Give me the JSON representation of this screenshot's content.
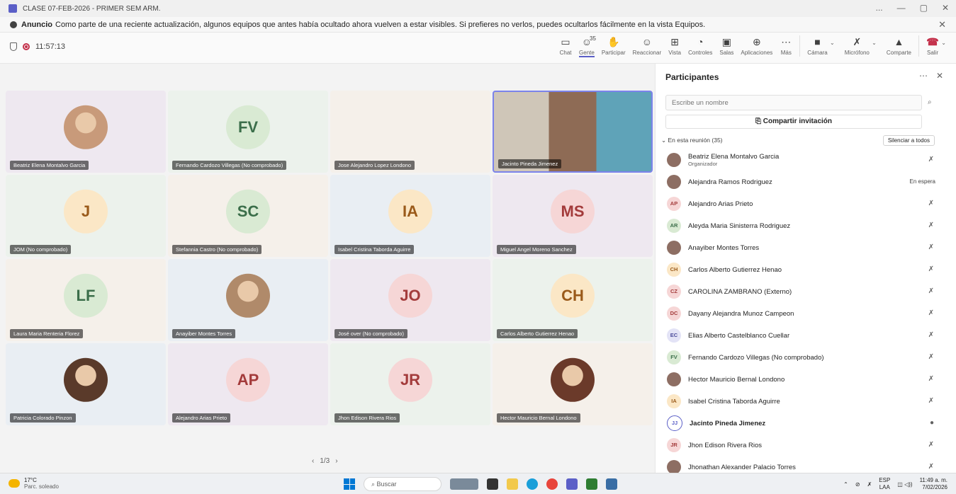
{
  "window": {
    "title": "CLASE 07-FEB-2026 - PRIMER SEM ARM.",
    "controls": [
      "...",
      "—",
      "▢",
      "✕"
    ]
  },
  "announcement": {
    "label": "Anuncio",
    "text": "Como parte de una reciente actualización, algunos equipos que antes había ocultado ahora vuelven a estar visibles. Si prefieres no verlos, puedes ocultarlos fácilmente en la vista Equipos."
  },
  "meeting": {
    "timer": "11:57:13"
  },
  "toolbar": {
    "chat": "Chat",
    "people": "Gente",
    "people_count": "35",
    "raise": "Participar",
    "react": "Reaccionar",
    "view": "Vista",
    "controls": "Controles",
    "rooms": "Salas",
    "apps": "Aplicaciones",
    "more": "Más",
    "camera": "Cámara",
    "mic": "Micrófono",
    "share": "Comparte",
    "leave": "Salir"
  },
  "tiles": [
    {
      "name": "Beatriz Elena Montalvo Garcia",
      "initials": "",
      "photo_color": "#c89a7a"
    },
    {
      "name": "Fernando Cardozo Villegas (No comprobado)",
      "initials": "FV",
      "color": "#d9ead3",
      "text_color": "#3b6e4a"
    },
    {
      "name": "Jose Alejandro Lopez Londono",
      "initials": "",
      "photo_color": ""
    },
    {
      "name": "Jacinto Pineda Jimenez",
      "initials": "",
      "photo_color": "#a07860"
    },
    {
      "name": "JOM (No comprobado)",
      "initials": "J",
      "color": "#fbe7c6",
      "text_color": "#9a5a1a"
    },
    {
      "name": "Stefannia Castro (No comprobado)",
      "initials": "SC",
      "color": "#d9ead3",
      "text_color": "#3b6e4a"
    },
    {
      "name": "Isabel Cristina Taborda Aguirre",
      "initials": "IA",
      "color": "#fbe7c6",
      "text_color": "#9a5a1a"
    },
    {
      "name": "Miguel Angel Moreno Sanchez",
      "initials": "MS",
      "color": "#f6d6d6",
      "text_color": "#a33b3b"
    },
    {
      "name": "Laura Maria Renteria Florez",
      "initials": "LF",
      "color": "#d9ead3",
      "text_color": "#3b6e4a"
    },
    {
      "name": "Anayiber Montes Torres",
      "initials": "",
      "photo_color": "#b08a6a"
    },
    {
      "name": "José over (No comprobado)",
      "initials": "JO",
      "color": "#f6d6d6",
      "text_color": "#a33b3b"
    },
    {
      "name": "Carlos Alberto Gutierrez Henao",
      "initials": "CH",
      "color": "#fbe7c6",
      "text_color": "#9a5a1a"
    },
    {
      "name": "Patricia Colorado Pinzon",
      "initials": "",
      "photo_color": "#5a3a2a"
    },
    {
      "name": "Alejandro Arias Prieto",
      "initials": "AP",
      "color": "#f6d6d6",
      "text_color": "#a33b3b"
    },
    {
      "name": "Jhon Edison Rivera Rios",
      "initials": "JR",
      "color": "#f6d6d6",
      "text_color": "#a33b3b"
    },
    {
      "name": "Hector Mauricio Bernal Londono",
      "initials": "",
      "photo_color": "#6b3a2a"
    }
  ],
  "pager": {
    "prev": "‹",
    "text": "1/3",
    "next": "›"
  },
  "panel": {
    "title": "Participantes",
    "search_placeholder": "Escribe un nombre",
    "invite": "Compartir invitación",
    "section": "En esta reunión (35)",
    "mute_all": "Silenciar a todos",
    "participants": [
      {
        "name": "Beatriz Elena Montalvo Garcia",
        "role": "Organizador",
        "initials": "",
        "status": ""
      },
      {
        "name": "Alejandra Ramos Rodriguez",
        "role": "",
        "initials": "",
        "status": "En espera"
      },
      {
        "name": "Alejandro Arias Prieto",
        "role": "",
        "initials": "AP",
        "status": ""
      },
      {
        "name": "Aleyda Maria Sinisterra Rodriguez",
        "role": "",
        "initials": "AR",
        "status": ""
      },
      {
        "name": "Anayiber Montes Torres",
        "role": "",
        "initials": "",
        "status": ""
      },
      {
        "name": "Carlos Alberto Gutierrez Henao",
        "role": "",
        "initials": "CH",
        "status": ""
      },
      {
        "name": "CAROLINA ZAMBRANO (Externo)",
        "role": "",
        "initials": "CZ",
        "status": ""
      },
      {
        "name": "Dayany Alejandra Munoz Campeon",
        "role": "",
        "initials": "DC",
        "status": ""
      },
      {
        "name": "Elias Alberto Castelblanco Cuellar",
        "role": "",
        "initials": "EC",
        "status": ""
      },
      {
        "name": "Fernando Cardozo Villegas (No comprobado)",
        "role": "",
        "initials": "FV",
        "status": ""
      },
      {
        "name": "Hector Mauricio Bernal Londono",
        "role": "",
        "initials": "",
        "status": ""
      },
      {
        "name": "Isabel Cristina Taborda Aguirre",
        "role": "",
        "initials": "IA",
        "status": ""
      },
      {
        "name": "Jacinto Pineda Jimenez",
        "role": "",
        "initials": "JJ",
        "status": ""
      },
      {
        "name": "Jhon Edison Rivera Rios",
        "role": "",
        "initials": "JR",
        "status": ""
      },
      {
        "name": "Jhonathan Alexander Palacio Torres",
        "role": "",
        "initials": "",
        "status": ""
      }
    ]
  },
  "taskbar": {
    "temp": "17°C",
    "weather": "Parc. soleado",
    "search": "Buscar",
    "lang1": "ESP",
    "lang2": "LAA",
    "time": "11:49 a. m.",
    "date": "7/02/2026"
  }
}
